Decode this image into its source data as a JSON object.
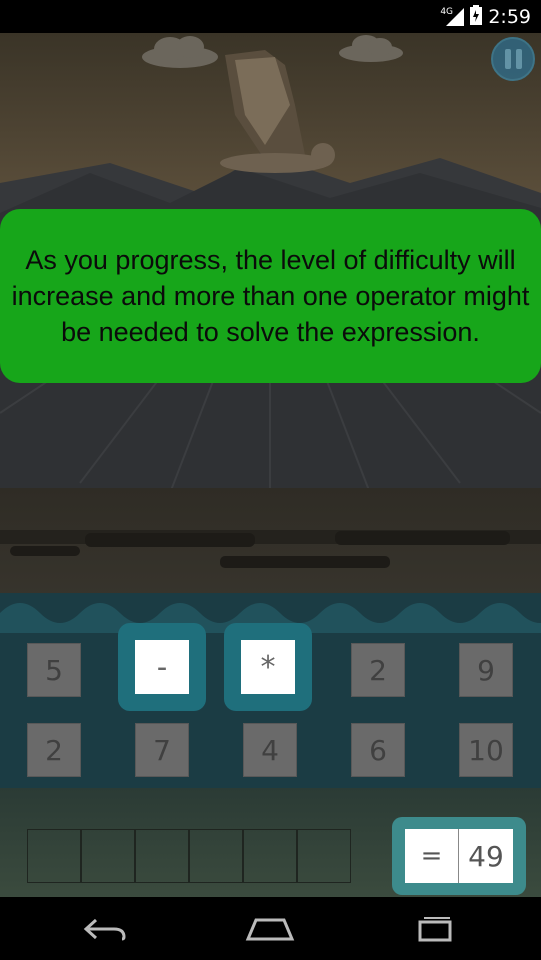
{
  "status_bar": {
    "network": "4G",
    "time": "2:59"
  },
  "game": {
    "tip_text": "As you progress, the level of difficulty will increase and more than one operator might be needed to solve the expression.",
    "number_row_1": [
      "5",
      "",
      "",
      "2",
      "9"
    ],
    "operators": [
      "-",
      "*"
    ],
    "number_row_2": [
      "2",
      "7",
      "4",
      "6",
      "10"
    ],
    "answer": {
      "equals": "=",
      "value": "49"
    }
  },
  "icons": {
    "pause": "pause-icon",
    "back": "back-icon",
    "home": "home-icon",
    "recents": "recents-icon",
    "battery": "battery-icon",
    "signal": "signal-icon"
  },
  "colors": {
    "tip_background": "#17a61a",
    "operator_holder": "#1f6f7c",
    "answer_holder": "#3d8b8c"
  }
}
